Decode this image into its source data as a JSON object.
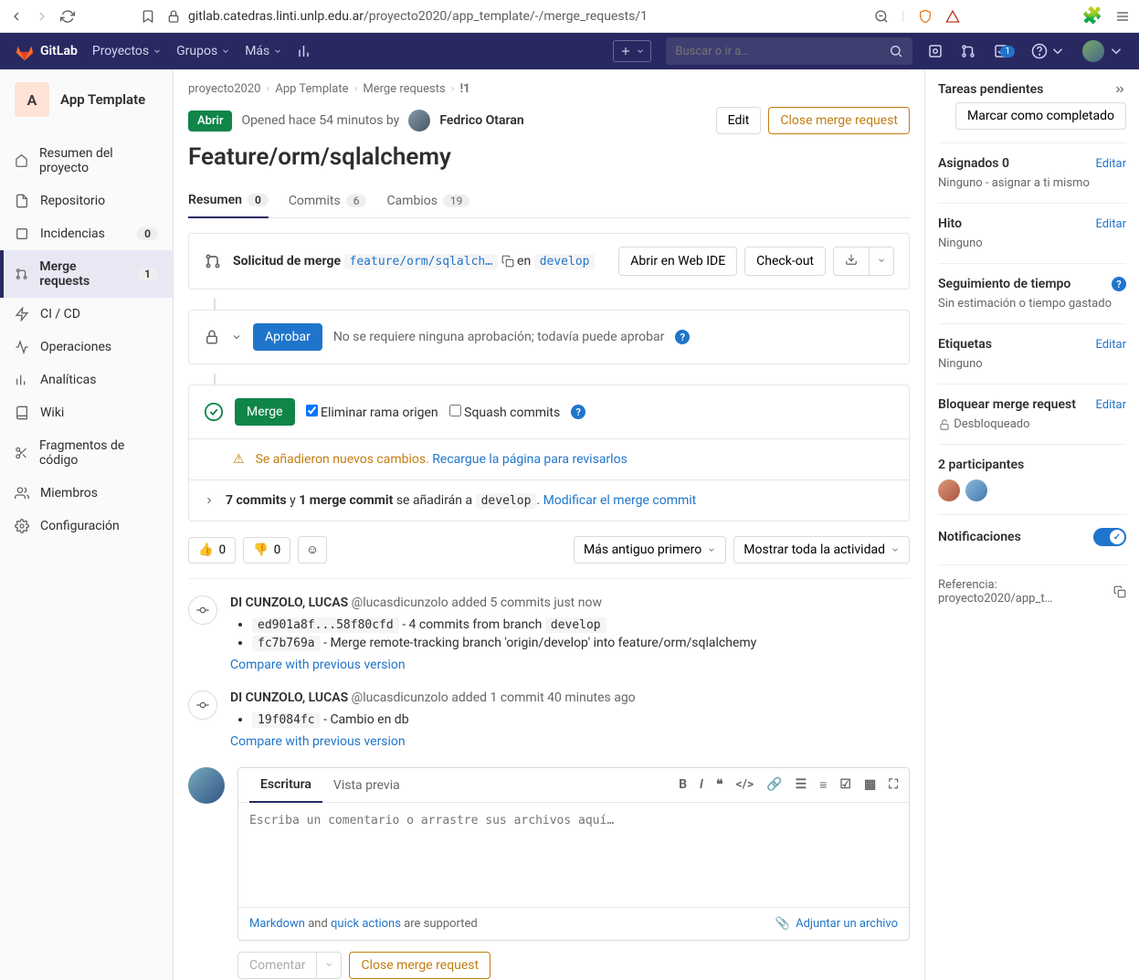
{
  "browser": {
    "url_host": "gitlab.catedras.linti.unlp.edu.ar",
    "url_path": "/proyecto2020/app_template/-/merge_requests/1"
  },
  "topnav": {
    "brand": "GitLab",
    "items": [
      "Proyectos",
      "Grupos",
      "Más"
    ],
    "search_placeholder": "Buscar o ir a…",
    "todo_count": "1"
  },
  "sidebar": {
    "badge": "A",
    "project": "App Template",
    "items": [
      {
        "label": "Resumen del proyecto",
        "count": null
      },
      {
        "label": "Repositorio",
        "count": null
      },
      {
        "label": "Incidencias",
        "count": "0"
      },
      {
        "label": "Merge requests",
        "count": "1"
      },
      {
        "label": "CI / CD",
        "count": null
      },
      {
        "label": "Operaciones",
        "count": null
      },
      {
        "label": "Analíticas",
        "count": null
      },
      {
        "label": "Wiki",
        "count": null
      },
      {
        "label": "Fragmentos de código",
        "count": null
      },
      {
        "label": "Miembros",
        "count": null
      },
      {
        "label": "Configuración",
        "count": null
      }
    ]
  },
  "breadcrumb": [
    "proyecto2020",
    "App Template",
    "Merge requests",
    "!1"
  ],
  "mr": {
    "status": "Abrir",
    "opened": "Opened hace 54 minutos by",
    "author": "Fedrico Otaran",
    "title": "Feature/orm/sqlalchemy",
    "edit": "Edit",
    "close": "Close merge request"
  },
  "tabs": [
    {
      "label": "Resumen",
      "badge": "0"
    },
    {
      "label": "Commits",
      "badge": "6"
    },
    {
      "label": "Cambios",
      "badge": "19"
    }
  ],
  "mergebox": {
    "request_label": "Solicitud de merge",
    "source_branch": "feature/orm/sqlalch…",
    "into": "en",
    "target_branch": "develop",
    "open_ide": "Abrir en Web IDE",
    "checkout": "Check-out",
    "approve": "Aprobar",
    "approve_hint": "No se requiere ninguna aprobación; todavía puede aprobar",
    "merge": "Merge",
    "delete_branch": "Eliminar rama origen",
    "squash": "Squash commits",
    "warn": "Se añadieron nuevos cambios.",
    "warn_link": "Recargue la página para revisarlos",
    "commit_summary_pre": "7 commits",
    "commit_summary_and": "y",
    "commit_summary_merge": "1 merge commit",
    "commit_summary_post": "se añadirán a",
    "commit_target": "develop",
    "modify_link": "Modificar el merge commit"
  },
  "reactions": {
    "thumbs_up": "0",
    "thumbs_down": "0",
    "sort": "Más antiguo primero",
    "filter": "Mostrar toda la actividad"
  },
  "activity": [
    {
      "author": "DI CUNZOLO, LUCAS",
      "handle": "@lucasdicunzolo",
      "action": "added 5 commits",
      "time": "just now",
      "items": [
        {
          "sha": "ed901a8f...58f80cfd",
          "text": " - 4 commits from branch ",
          "branch": "develop"
        },
        {
          "sha": "fc7b769a",
          "text": " - Merge remote-tracking branch 'origin/develop' into feature/orm/sqlalchemy"
        }
      ],
      "compare": "Compare with previous version"
    },
    {
      "author": "DI CUNZOLO, LUCAS",
      "handle": "@lucasdicunzolo",
      "action": "added 1 commit",
      "time": "40 minutes ago",
      "items": [
        {
          "sha": "19f084fc",
          "text": " - Cambio en db"
        }
      ],
      "compare": "Compare with previous version"
    }
  ],
  "comment": {
    "tab_write": "Escritura",
    "tab_preview": "Vista previa",
    "placeholder": "Escriba un comentario o arrastre sus archivos aquí…",
    "markdown": "Markdown",
    "and": " and ",
    "quick": "quick actions",
    "supported": " are supported",
    "attach": "Adjuntar un archivo",
    "submit": "Comentar",
    "close": "Close merge request"
  },
  "right": {
    "todo_title": "Tareas pendientes",
    "mark_done": "Marcar como completado",
    "assignees_title": "Asignados 0",
    "assignees_value": "Ninguno - asignar a ti mismo",
    "milestone_title": "Hito",
    "milestone_value": "Ninguno",
    "time_title": "Seguimiento de tiempo",
    "time_value": "Sin estimación o tiempo gastado",
    "labels_title": "Etiquetas",
    "labels_value": "Ninguno",
    "lock_title": "Bloquear merge request",
    "lock_value": "Desbloqueado",
    "participants": "2 participantes",
    "notifications": "Notificaciones",
    "reference": "Referencia: proyecto2020/app_t…",
    "edit": "Editar"
  }
}
